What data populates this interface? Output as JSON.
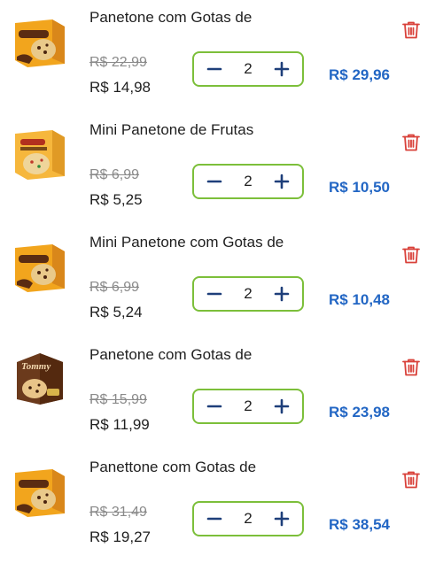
{
  "cart": {
    "items": [
      {
        "name": "Panetone com Gotas de",
        "old_price": "R$ 22,99",
        "price": "R$ 14,98",
        "quantity": "2",
        "total": "R$ 29,96",
        "image": "chocottone-box"
      },
      {
        "name": "Mini Panetone de Frutas",
        "old_price": "R$ 6,99",
        "price": "R$ 5,25",
        "quantity": "2",
        "total": "R$ 10,50",
        "image": "panettone-box"
      },
      {
        "name": "Mini Panetone com Gotas de",
        "old_price": "R$ 6,99",
        "price": "R$ 5,24",
        "quantity": "2",
        "total": "R$ 10,48",
        "image": "chocottone-box"
      },
      {
        "name": "Panetone com Gotas de",
        "old_price": "R$ 15,99",
        "price": "R$ 11,99",
        "quantity": "2",
        "total": "R$ 23,98",
        "image": "tommy-box"
      },
      {
        "name": "Panettone com Gotas de",
        "old_price": "R$ 31,49",
        "price": "R$ 19,27",
        "quantity": "2",
        "total": "R$ 38,54",
        "image": "chocottone-box"
      }
    ]
  },
  "icons": {
    "decrement": "minus-icon",
    "increment": "plus-icon",
    "remove": "trash-icon"
  },
  "colors": {
    "total_price": "#2266c4",
    "stepper_border": "#7cbf3a",
    "stepper_icon": "#1e3f7a",
    "trash": "#d9413a",
    "old_price": "#8a8a8a"
  }
}
